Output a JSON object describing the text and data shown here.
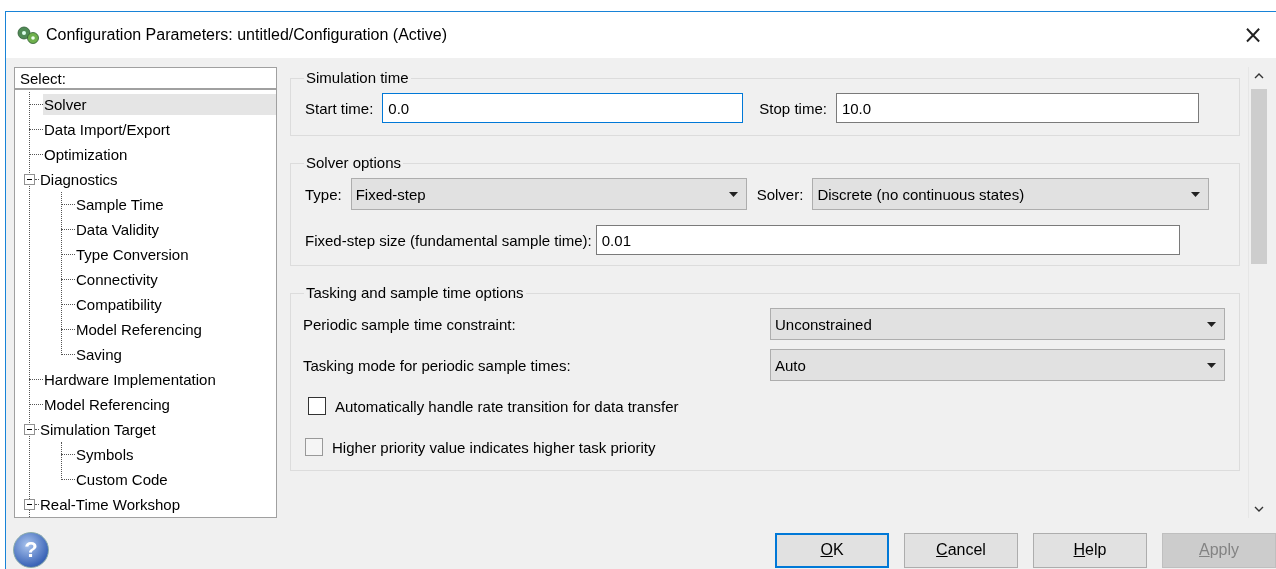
{
  "window": {
    "title": "Configuration Parameters: untitled/Configuration (Active)",
    "close": "×"
  },
  "tree": {
    "header": "Select:",
    "items": [
      {
        "label": "Solver",
        "selected": true
      },
      {
        "label": "Data Import/Export",
        "selected": false
      },
      {
        "label": "Optimization",
        "selected": false
      },
      {
        "label": "Diagnostics",
        "selected": false,
        "expanded": true,
        "children": [
          {
            "label": "Sample Time",
            "selected": false
          },
          {
            "label": "Data Validity",
            "selected": false
          },
          {
            "label": "Type Conversion",
            "selected": false
          },
          {
            "label": "Connectivity",
            "selected": false
          },
          {
            "label": "Compatibility",
            "selected": false
          },
          {
            "label": "Model Referencing",
            "selected": false
          },
          {
            "label": "Saving",
            "selected": false
          }
        ]
      },
      {
        "label": "Hardware Implementation",
        "selected": false
      },
      {
        "label": "Model Referencing",
        "selected": false
      },
      {
        "label": "Simulation Target",
        "selected": false,
        "expanded": true,
        "children": [
          {
            "label": "Symbols",
            "selected": false
          },
          {
            "label": "Custom Code",
            "selected": false
          }
        ]
      },
      {
        "label": "Real-Time Workshop",
        "selected": false,
        "expanded": true
      }
    ]
  },
  "simulation_time": {
    "title": "Simulation time",
    "start_time": {
      "label": "Start time:",
      "value": "0.0",
      "focused": true
    },
    "stop_time": {
      "label": "Stop time:",
      "value": "10.0",
      "focused": false
    }
  },
  "solver_options": {
    "title": "Solver options",
    "type": {
      "label": "Type:",
      "value": "Fixed-step"
    },
    "solver": {
      "label": "Solver:",
      "value": "Discrete (no continuous states)"
    },
    "step_size": {
      "label": "Fixed-step size (fundamental sample time):",
      "value": "0.01",
      "focused": false
    }
  },
  "tasking": {
    "title": "Tasking and sample time options",
    "dropdowns": [
      {
        "label": "Periodic sample time constraint:",
        "value": "Unconstrained"
      },
      {
        "label": "Tasking mode for periodic sample times:",
        "value": "Auto"
      }
    ],
    "checkboxes": [
      {
        "label": "Automatically handle rate transition for data transfer",
        "checked": false,
        "disabled": false
      },
      {
        "label": "Higher priority value indicates higher task priority",
        "checked": false,
        "disabled": true
      }
    ]
  },
  "help_icon": "?",
  "buttons": [
    {
      "label": "OK",
      "default": true,
      "disabled": false
    },
    {
      "label": "Cancel",
      "default": false,
      "disabled": false
    },
    {
      "label": "Help",
      "default": false,
      "disabled": false
    },
    {
      "label": "Apply",
      "default": false,
      "disabled": true
    }
  ]
}
